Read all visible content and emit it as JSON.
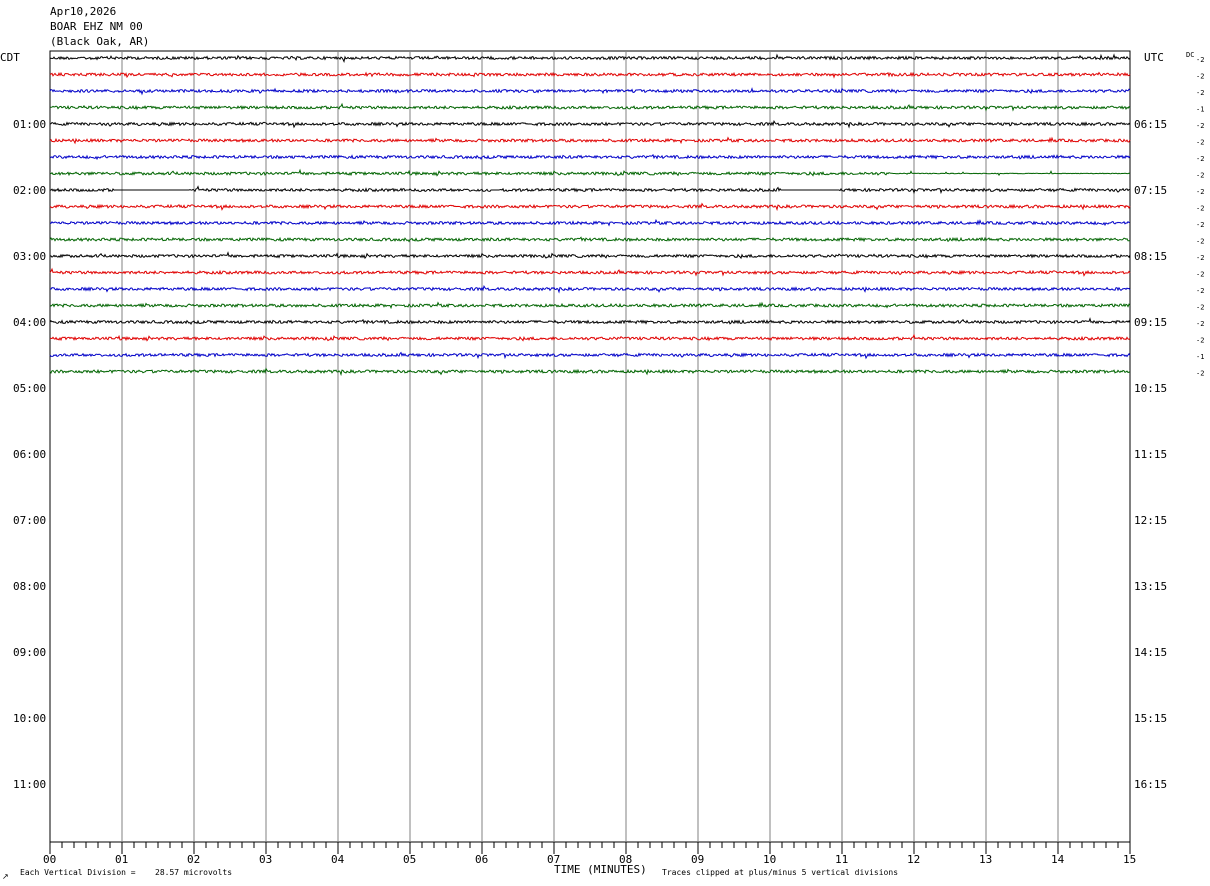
{
  "header": {
    "date": "Apr10,2026",
    "station": "BOAR EHZ NM 00",
    "location": "(Black Oak, AR)"
  },
  "footer": {
    "division_label": "Each Vertical Division =",
    "division_value": "28.57 microvolts",
    "clip_note": "Traces clipped at plus/minus 5 vertical divisions",
    "mark": "↗"
  },
  "chart_data": {
    "type": "line",
    "title": "BOAR EHZ NM 00 (Black Oak, AR)",
    "xlabel": "TIME (MINUTES)",
    "xlim": [
      0,
      15
    ],
    "x_ticks": [
      "00",
      "01",
      "02",
      "03",
      "04",
      "05",
      "06",
      "07",
      "08",
      "09",
      "10",
      "11",
      "12",
      "13",
      "14",
      "15"
    ],
    "left_axis_label": "CDT",
    "right_axis_label": "UTC",
    "dc_label": "DC",
    "left_hour_labels": [
      "01:00",
      "02:00",
      "03:00",
      "04:00",
      "05:00",
      "06:00",
      "07:00",
      "08:00",
      "09:00",
      "10:00",
      "11:00"
    ],
    "right_hour_labels": [
      "06:15",
      "07:15",
      "08:15",
      "09:15",
      "10:15",
      "11:15",
      "12:15",
      "13:15",
      "14:15",
      "15:15",
      "16:15"
    ],
    "trace_colors": [
      "#000000",
      "#e00000",
      "#0000c8",
      "#006400"
    ],
    "trace_dc_offsets": [
      -2,
      -2,
      -2,
      -1,
      -2,
      -2,
      -2,
      -2,
      -2,
      -2,
      -2,
      -2,
      -2,
      -2,
      -2,
      -2,
      -2,
      -2,
      -1,
      -2
    ],
    "traces_recorded": 20,
    "grid": true
  }
}
